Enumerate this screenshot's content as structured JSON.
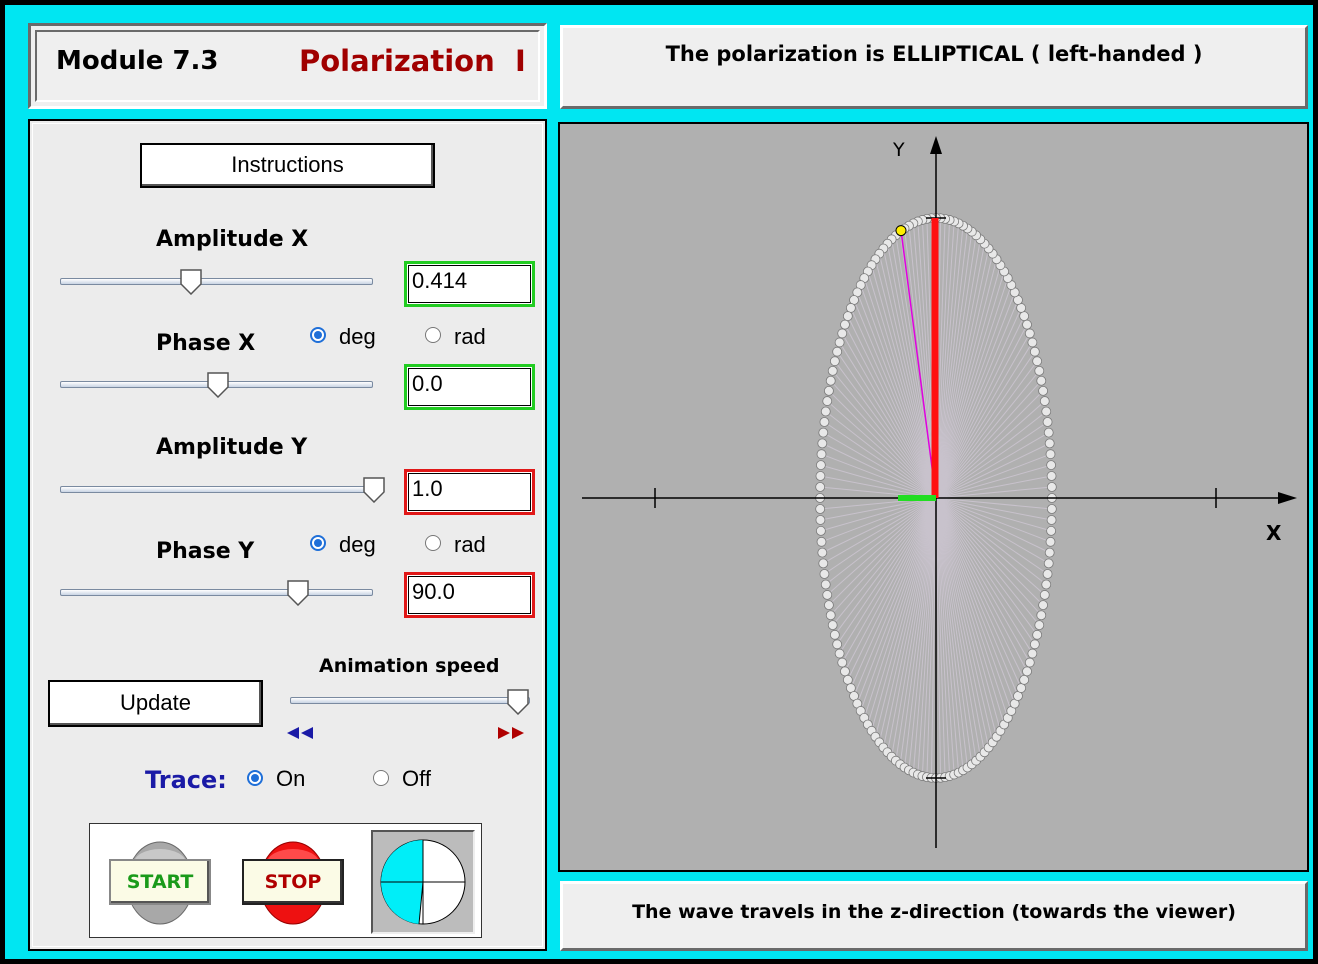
{
  "header": {
    "module": "Module 7.3",
    "title": "Polarization  I",
    "title_color": "#a00000"
  },
  "status": {
    "message": "The polarization is ELLIPTICAL ( left-handed )"
  },
  "footer": {
    "message": "The wave travels in the z-direction (towards the viewer)"
  },
  "controls": {
    "instructions_label": "Instructions",
    "amplitude_x": {
      "label": "Amplitude X",
      "value": "0.414",
      "slider_fraction": 0.414
    },
    "phase_x": {
      "label": "Phase X",
      "value": "0.0",
      "slider_fraction": 0.5,
      "unit_deg": "deg",
      "unit_rad": "rad",
      "selected_unit": "deg"
    },
    "amplitude_y": {
      "label": "Amplitude Y",
      "value": "1.0",
      "slider_fraction": 1.0
    },
    "phase_y": {
      "label": "Phase Y",
      "value": "90.0",
      "slider_fraction": 0.75,
      "unit_deg": "deg",
      "unit_rad": "rad",
      "selected_unit": "deg"
    },
    "update_label": "Update",
    "animation_speed": {
      "label": "Animation speed",
      "slider_fraction": 1.0,
      "slower_icon": "rewind-icon",
      "faster_icon": "fast-forward-icon"
    },
    "trace": {
      "label": "Trace:",
      "on_label": "On",
      "off_label": "Off",
      "selected": "On",
      "label_color": "#1a1aa6"
    },
    "start_label": "START",
    "stop_label": "STOP",
    "start_color": "#1a9a1a",
    "stop_color": "#b00000"
  },
  "plot": {
    "x_axis_label": "X",
    "y_axis_label": "Y",
    "amplitude_x": 0.414,
    "amplitude_y": 1.0,
    "field_x_component": -0.0,
    "field_y_component": 1.0,
    "trace_on": true,
    "background": "#b0b0b0",
    "x_component_color": "#22dd22",
    "y_component_color": "#ff1010",
    "resultant_color": "#e000e0"
  }
}
